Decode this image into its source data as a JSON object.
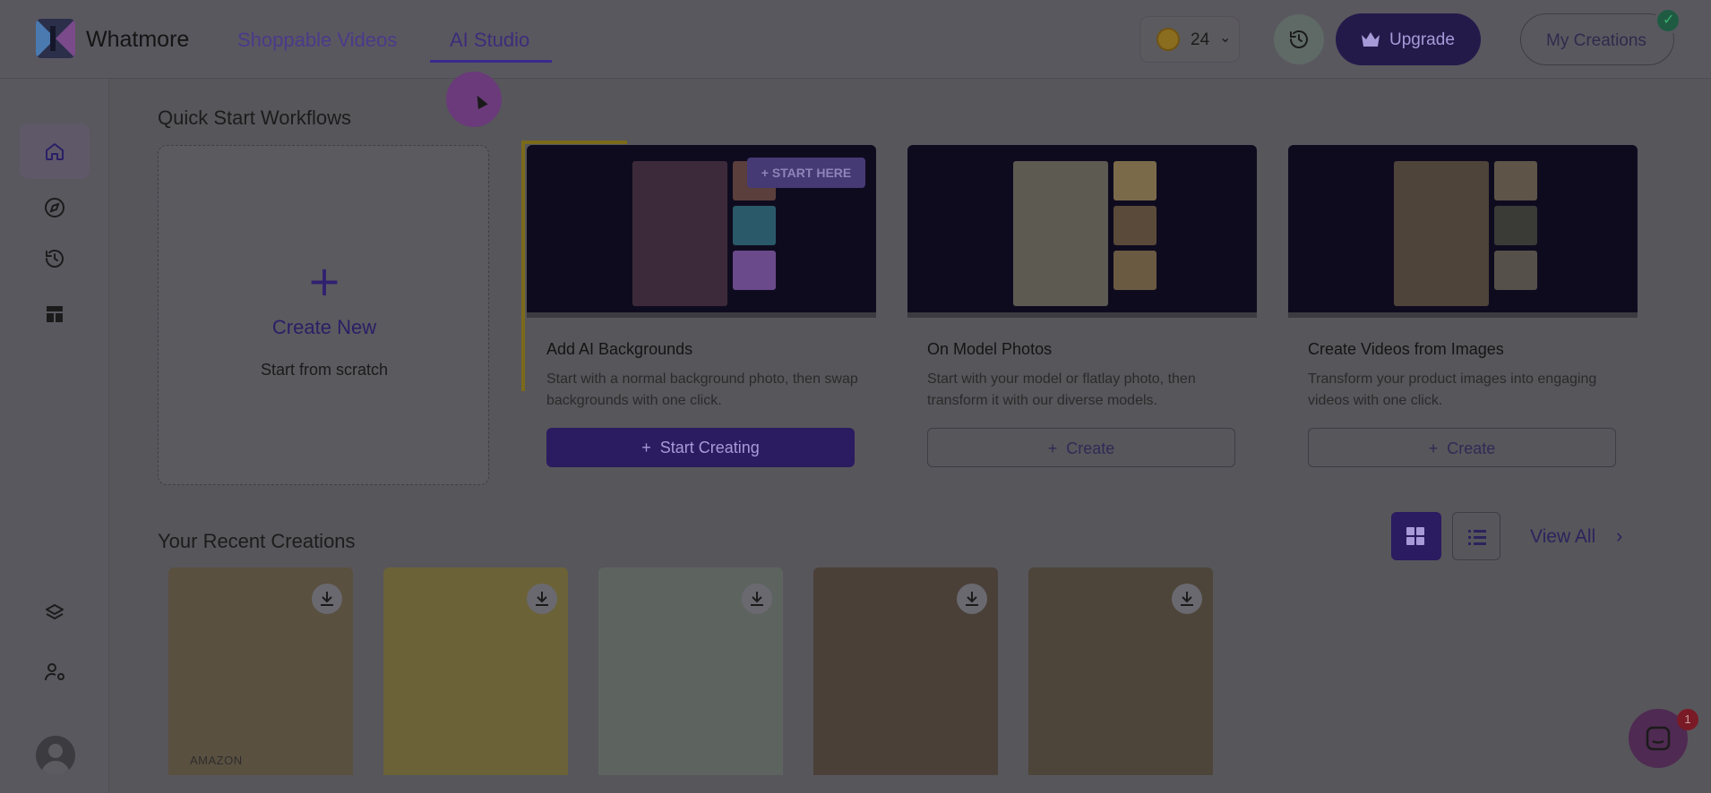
{
  "app": {
    "name": "Whatmore"
  },
  "nav": {
    "items": [
      "Shoppable Videos",
      "AI Studio"
    ],
    "active": "AI Studio"
  },
  "header": {
    "credits": "24",
    "upgrade_label": "Upgrade",
    "my_creations_label": "My Creations"
  },
  "sidebar": {
    "top_icons": [
      "home-icon",
      "compass-icon",
      "history-icon",
      "templates-icon"
    ],
    "bottom_icons": [
      "layers-icon",
      "user-settings-icon",
      "profile-avatar-icon"
    ],
    "active": "home-icon"
  },
  "quick_start": {
    "title": "Quick Start Workflows",
    "create_new": {
      "title": "Create New",
      "subtitle": "Start from scratch"
    },
    "start_here_label": "+ START HERE",
    "workflows": [
      {
        "title": "Add AI Backgrounds",
        "description": "Start with a normal background photo, then swap backgrounds with one click.",
        "button": "Start Creating"
      },
      {
        "title": "On Model Photos",
        "description": "Start with your model or flatlay photo, then transform it with our diverse models.",
        "button": "Create"
      },
      {
        "title": "Create Videos from Images",
        "description": "Transform your product images into engaging videos with one click.",
        "button": "Create"
      }
    ]
  },
  "recent": {
    "title": "Your Recent Creations",
    "view_all_label": "View All",
    "view_mode": "grid",
    "first_card_label": "AMAZON"
  },
  "chat": {
    "badge_count": "1"
  },
  "colors": {
    "brand_purple": "#5b3fd6",
    "overlay": "rgba(0,0,0,0.62)"
  }
}
